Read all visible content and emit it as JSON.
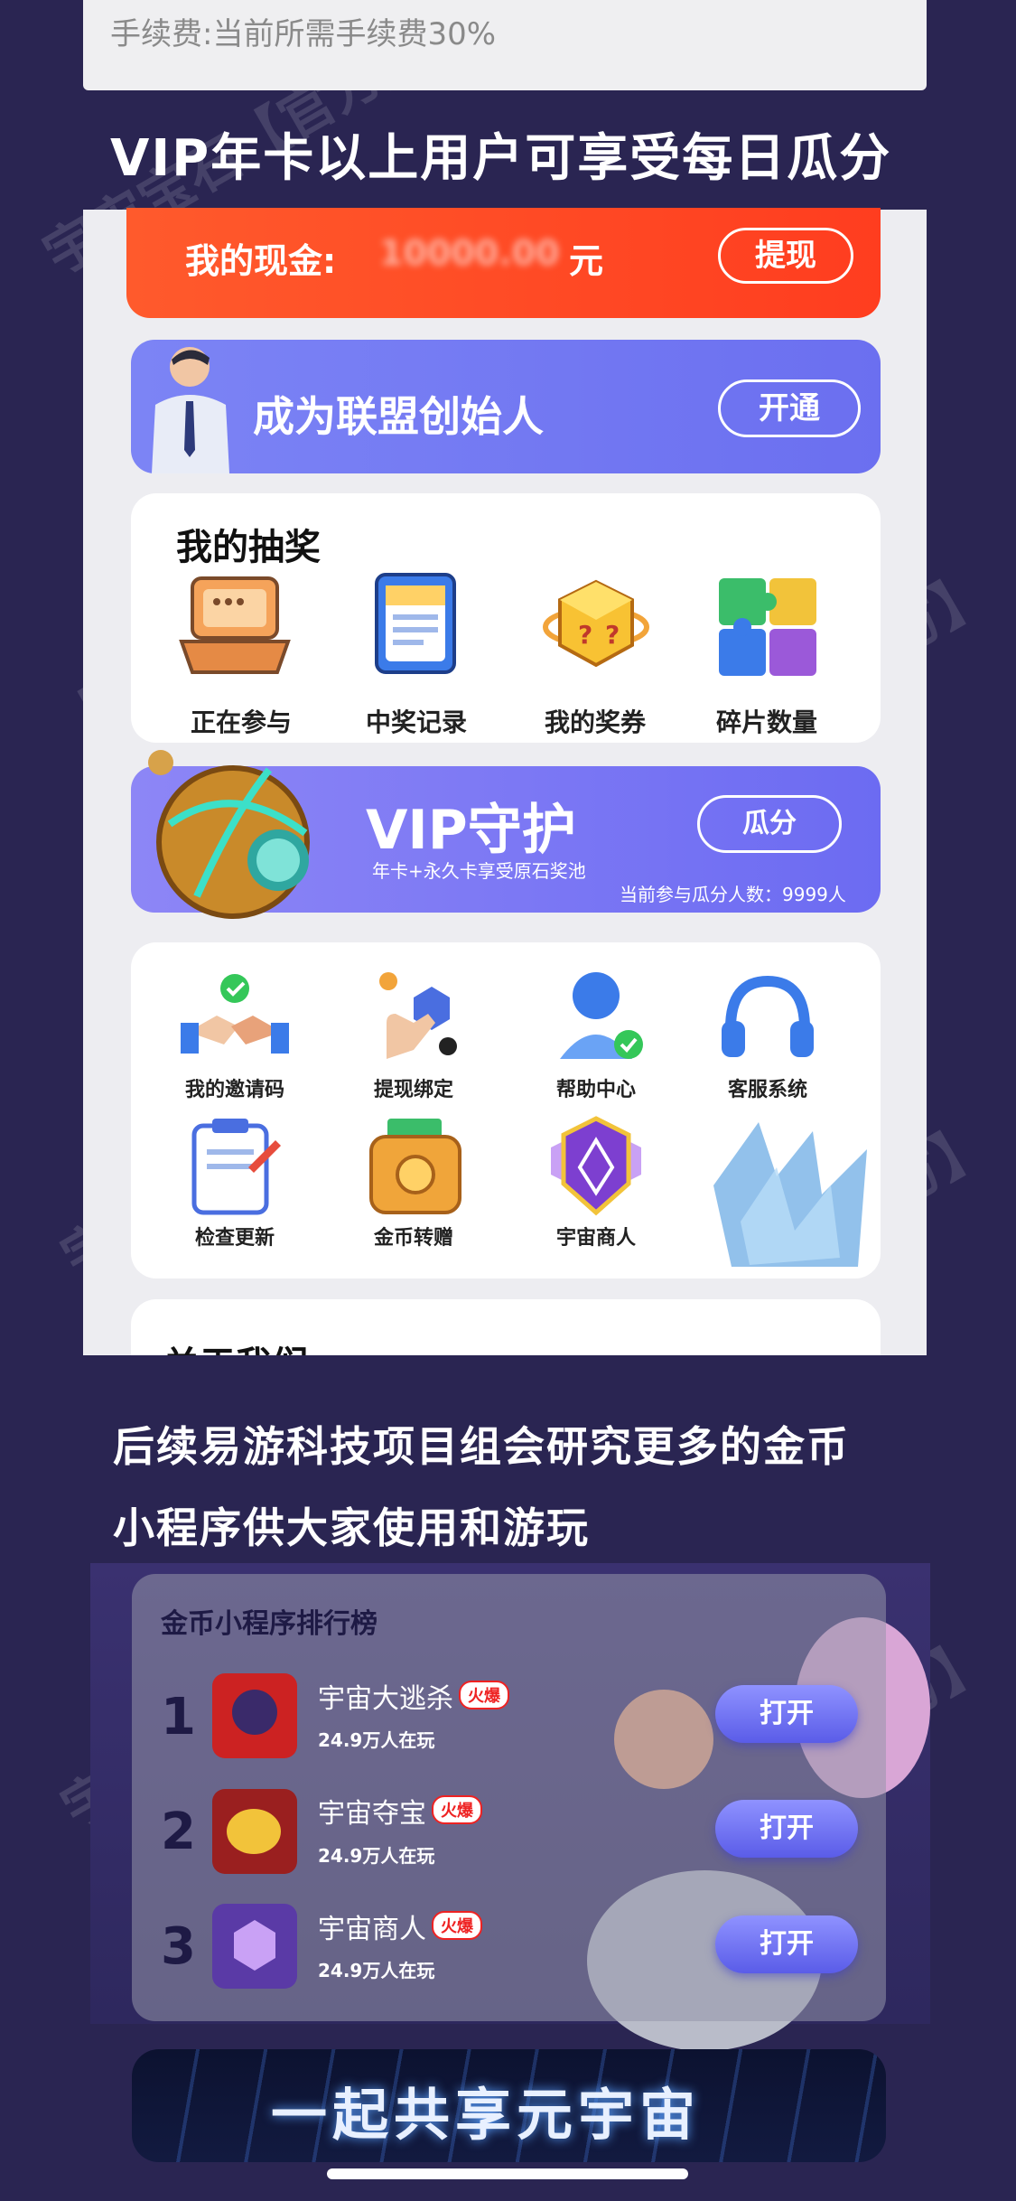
{
  "fee_line": "手续费:当前所需手续费30%",
  "heading_top": "VIP年卡以上用户可享受每日瓜分",
  "cash": {
    "label": "我的现金:",
    "amount": "10000.00",
    "unit": "元",
    "button": "提现"
  },
  "founder": {
    "title": "成为联盟创始人",
    "button": "开通"
  },
  "lottery": {
    "title": "我的抽奖",
    "items": [
      {
        "label": "正在参与",
        "icon": "laptop-icon"
      },
      {
        "label": "中奖记录",
        "icon": "calendar-icon"
      },
      {
        "label": "我的奖券",
        "icon": "lucky-cube-icon"
      },
      {
        "label": "碎片数量",
        "icon": "puzzle-icon"
      }
    ]
  },
  "vip": {
    "title": "VIP守护",
    "subtitle": "年卡+永久卡享受原石奖池",
    "button": "瓜分",
    "count_text": "当前参与瓜分人数：9999人"
  },
  "services": {
    "items": [
      {
        "label": "我的邀请码",
        "icon": "handshake-icon"
      },
      {
        "label": "提现绑定",
        "icon": "hand-tap-icon"
      },
      {
        "label": "帮助中心",
        "icon": "help-user-icon"
      },
      {
        "label": "客服系统",
        "icon": "headset-icon"
      },
      {
        "label": "检查更新",
        "icon": "clipboard-icon"
      },
      {
        "label": "金币转赠",
        "icon": "wallet-icon"
      },
      {
        "label": "宇宙商人",
        "icon": "emblem-icon"
      }
    ]
  },
  "about_title": "关于我们",
  "heading_mid_1": "后续易游科技项目组会研究更多的金币",
  "heading_mid_2": "小程序供大家使用和游玩",
  "board": {
    "title": "金币小程序排行榜",
    "hot_label": "火爆",
    "open_label": "打开",
    "rows": [
      {
        "rank": "1",
        "name": "宇宙大逃杀",
        "players": "24.9万人在玩"
      },
      {
        "rank": "2",
        "name": "宇宙夺宝",
        "players": "24.9万人在玩"
      },
      {
        "rank": "3",
        "name": "宇宙商人",
        "players": "24.9万人在玩"
      }
    ]
  },
  "banner_text": "一起共享元宇宙",
  "watermark": "宇宙宝石【官方】",
  "colors": {
    "background": "#2a2552",
    "cash_red": "#ff4a24",
    "vip_purple": "#7470f3",
    "button_purple": "#6d6ff0"
  }
}
